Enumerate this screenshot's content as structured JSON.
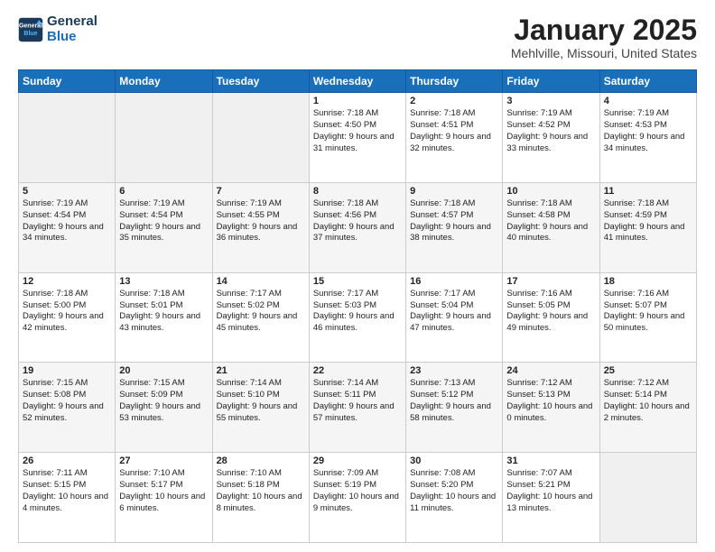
{
  "header": {
    "logo_line1": "General",
    "logo_line2": "Blue",
    "title": "January 2025",
    "subtitle": "Mehlville, Missouri, United States"
  },
  "days": [
    "Sunday",
    "Monday",
    "Tuesday",
    "Wednesday",
    "Thursday",
    "Friday",
    "Saturday"
  ],
  "weeks": [
    [
      {
        "date": "",
        "empty": true
      },
      {
        "date": "",
        "empty": true
      },
      {
        "date": "",
        "empty": true
      },
      {
        "date": "1",
        "sunrise": "7:18 AM",
        "sunset": "4:50 PM",
        "daylight": "9 hours and 31 minutes."
      },
      {
        "date": "2",
        "sunrise": "7:18 AM",
        "sunset": "4:51 PM",
        "daylight": "9 hours and 32 minutes."
      },
      {
        "date": "3",
        "sunrise": "7:19 AM",
        "sunset": "4:52 PM",
        "daylight": "9 hours and 33 minutes."
      },
      {
        "date": "4",
        "sunrise": "7:19 AM",
        "sunset": "4:53 PM",
        "daylight": "9 hours and 34 minutes."
      }
    ],
    [
      {
        "date": "5",
        "sunrise": "7:19 AM",
        "sunset": "4:54 PM",
        "daylight": "9 hours and 34 minutes."
      },
      {
        "date": "6",
        "sunrise": "7:19 AM",
        "sunset": "4:54 PM",
        "daylight": "9 hours and 35 minutes."
      },
      {
        "date": "7",
        "sunrise": "7:19 AM",
        "sunset": "4:55 PM",
        "daylight": "9 hours and 36 minutes."
      },
      {
        "date": "8",
        "sunrise": "7:18 AM",
        "sunset": "4:56 PM",
        "daylight": "9 hours and 37 minutes."
      },
      {
        "date": "9",
        "sunrise": "7:18 AM",
        "sunset": "4:57 PM",
        "daylight": "9 hours and 38 minutes."
      },
      {
        "date": "10",
        "sunrise": "7:18 AM",
        "sunset": "4:58 PM",
        "daylight": "9 hours and 40 minutes."
      },
      {
        "date": "11",
        "sunrise": "7:18 AM",
        "sunset": "4:59 PM",
        "daylight": "9 hours and 41 minutes."
      }
    ],
    [
      {
        "date": "12",
        "sunrise": "7:18 AM",
        "sunset": "5:00 PM",
        "daylight": "9 hours and 42 minutes."
      },
      {
        "date": "13",
        "sunrise": "7:18 AM",
        "sunset": "5:01 PM",
        "daylight": "9 hours and 43 minutes."
      },
      {
        "date": "14",
        "sunrise": "7:17 AM",
        "sunset": "5:02 PM",
        "daylight": "9 hours and 45 minutes."
      },
      {
        "date": "15",
        "sunrise": "7:17 AM",
        "sunset": "5:03 PM",
        "daylight": "9 hours and 46 minutes."
      },
      {
        "date": "16",
        "sunrise": "7:17 AM",
        "sunset": "5:04 PM",
        "daylight": "9 hours and 47 minutes."
      },
      {
        "date": "17",
        "sunrise": "7:16 AM",
        "sunset": "5:05 PM",
        "daylight": "9 hours and 49 minutes."
      },
      {
        "date": "18",
        "sunrise": "7:16 AM",
        "sunset": "5:07 PM",
        "daylight": "9 hours and 50 minutes."
      }
    ],
    [
      {
        "date": "19",
        "sunrise": "7:15 AM",
        "sunset": "5:08 PM",
        "daylight": "9 hours and 52 minutes."
      },
      {
        "date": "20",
        "sunrise": "7:15 AM",
        "sunset": "5:09 PM",
        "daylight": "9 hours and 53 minutes."
      },
      {
        "date": "21",
        "sunrise": "7:14 AM",
        "sunset": "5:10 PM",
        "daylight": "9 hours and 55 minutes."
      },
      {
        "date": "22",
        "sunrise": "7:14 AM",
        "sunset": "5:11 PM",
        "daylight": "9 hours and 57 minutes."
      },
      {
        "date": "23",
        "sunrise": "7:13 AM",
        "sunset": "5:12 PM",
        "daylight": "9 hours and 58 minutes."
      },
      {
        "date": "24",
        "sunrise": "7:12 AM",
        "sunset": "5:13 PM",
        "daylight": "10 hours and 0 minutes."
      },
      {
        "date": "25",
        "sunrise": "7:12 AM",
        "sunset": "5:14 PM",
        "daylight": "10 hours and 2 minutes."
      }
    ],
    [
      {
        "date": "26",
        "sunrise": "7:11 AM",
        "sunset": "5:15 PM",
        "daylight": "10 hours and 4 minutes."
      },
      {
        "date": "27",
        "sunrise": "7:10 AM",
        "sunset": "5:17 PM",
        "daylight": "10 hours and 6 minutes."
      },
      {
        "date": "28",
        "sunrise": "7:10 AM",
        "sunset": "5:18 PM",
        "daylight": "10 hours and 8 minutes."
      },
      {
        "date": "29",
        "sunrise": "7:09 AM",
        "sunset": "5:19 PM",
        "daylight": "10 hours and 9 minutes."
      },
      {
        "date": "30",
        "sunrise": "7:08 AM",
        "sunset": "5:20 PM",
        "daylight": "10 hours and 11 minutes."
      },
      {
        "date": "31",
        "sunrise": "7:07 AM",
        "sunset": "5:21 PM",
        "daylight": "10 hours and 13 minutes."
      },
      {
        "date": "",
        "empty": true
      }
    ]
  ]
}
